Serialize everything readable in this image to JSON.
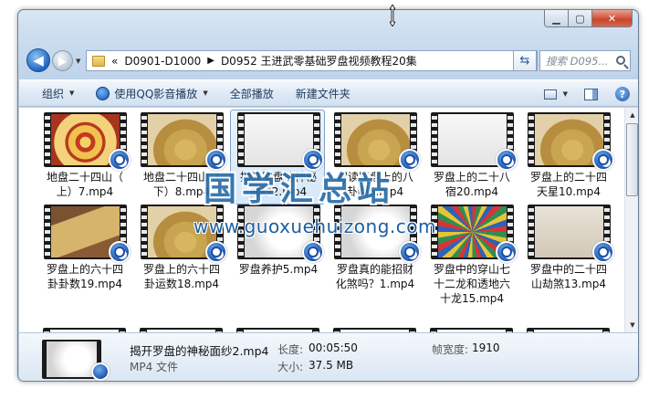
{
  "window": {
    "minimize": "▁",
    "maximize": "▢",
    "close": "✕"
  },
  "nav": {
    "back": "◀",
    "forward": "▶",
    "breadcrumbs": [
      "«",
      "D0901-D1000",
      "▶",
      "D0952 王进武零基础罗盘视频教程20集"
    ],
    "search_placeholder": "搜索 D095..."
  },
  "toolbar": {
    "organize": "组织",
    "play_qq": "使用QQ影音播放",
    "play_all": "全部播放",
    "new_folder": "新建文件夹",
    "help": "?"
  },
  "files": [
    {
      "line1": "地盘二十四山（",
      "line2": "上）7.mp4",
      "frame": "f-compass",
      "selected": false
    },
    {
      "line1": "地盘二十四山（",
      "line2": "下）8.mp4",
      "frame": "f-compass2",
      "selected": false
    },
    {
      "line1": "揭开罗盘的神秘",
      "line2": "面纱2.mp4",
      "frame": "f-white",
      "selected": true
    },
    {
      "line1": "解读罗盘上的八",
      "line2": "卦圈6.mp4",
      "frame": "f-compass2",
      "selected": false
    },
    {
      "line1": "罗盘上的二十八",
      "line2": "宿20.mp4",
      "frame": "f-white",
      "selected": false
    },
    {
      "line1": "罗盘上的二十四",
      "line2": "天星10.mp4",
      "frame": "f-compass2",
      "selected": false
    },
    {
      "line1": "罗盘上的六十四",
      "line2": "卦卦数19.mp4",
      "frame": "f-table",
      "selected": false
    },
    {
      "line1": "罗盘上的六十四",
      "line2": "卦运数18.mp4",
      "frame": "f-compass2",
      "selected": false
    },
    {
      "line1": "罗盘养护5.mp4",
      "line2": "",
      "frame": "f-white2",
      "selected": false
    },
    {
      "line1": "罗盘真的能招财",
      "line2": "化煞吗？1.mp4",
      "frame": "f-white2",
      "selected": false
    },
    {
      "line1": "罗盘中的穿山七",
      "line2": "十二龙和透地六",
      "line3": "十龙15.mp4",
      "frame": "f-color",
      "selected": false
    },
    {
      "line1": "罗盘中的二十四",
      "line2": "山劫煞13.mp4",
      "frame": "f-book",
      "selected": false
    }
  ],
  "details": {
    "name": "揭开罗盘的神秘面纱2.mp4",
    "type": "MP4 文件",
    "duration_label": "长度:",
    "duration": "00:05:50",
    "size_label": "大小:",
    "size": "37.5 MB",
    "width_label": "帧宽度:",
    "width": "1910"
  },
  "watermark": {
    "logo": "国学汇总站",
    "url": "www.guoxuehuizong.com"
  }
}
